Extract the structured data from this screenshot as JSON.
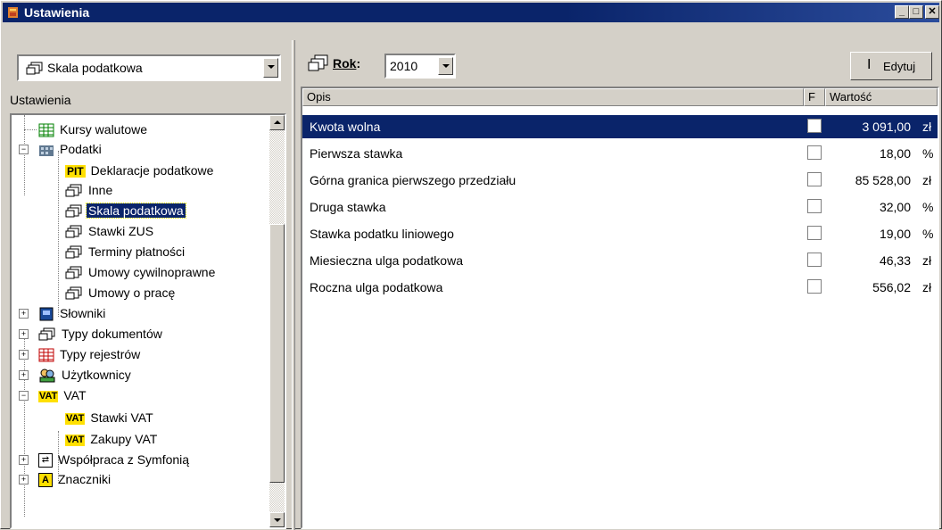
{
  "window": {
    "title": "Ustawienia"
  },
  "left": {
    "combo_value": "Skala podatkowa",
    "section_label": "Ustawienia",
    "tree": [
      {
        "label": "Kursy walutowe",
        "icon": "grid-table-icon"
      },
      {
        "label": "Podatki",
        "icon": "building-icon"
      },
      {
        "label": "Deklaracje podatkowe",
        "icon": "pit-icon"
      },
      {
        "label": "Inne",
        "icon": "folder-stack-icon"
      },
      {
        "label": "Skala podatkowa",
        "icon": "folder-stack-icon"
      },
      {
        "label": "Stawki ZUS",
        "icon": "folder-stack-icon"
      },
      {
        "label": "Terminy płatności",
        "icon": "folder-stack-icon"
      },
      {
        "label": "Umowy cywilnoprawne",
        "icon": "folder-stack-icon"
      },
      {
        "label": "Umowy o pracę",
        "icon": "folder-stack-icon"
      },
      {
        "label": "Słowniki",
        "icon": "dictionary-icon"
      },
      {
        "label": "Typy dokumentów",
        "icon": "folder-stack-icon"
      },
      {
        "label": "Typy rejestrów",
        "icon": "register-icon"
      },
      {
        "label": "Użytkownicy",
        "icon": "users-icon"
      },
      {
        "label": "VAT",
        "icon": "vat-icon"
      },
      {
        "label": "Stawki VAT",
        "icon": "vat-icon"
      },
      {
        "label": "Zakupy VAT",
        "icon": "vat-icon"
      },
      {
        "label": "Współpraca z Symfonią",
        "icon": "sync-icon"
      },
      {
        "label": "Znaczniki",
        "icon": "marker-icon"
      }
    ]
  },
  "right": {
    "rok_label": "Rok",
    "rok_colon": ":",
    "rok_value": "2010",
    "edit_label": "Edytuj",
    "columns": {
      "opis": "Opis",
      "f": "F",
      "wartosc": "Wartość"
    },
    "rows": [
      {
        "opis": "Kwota wolna",
        "value": "3 091,00",
        "unit": "zł"
      },
      {
        "opis": "Pierwsza stawka",
        "value": "18,00",
        "unit": "%"
      },
      {
        "opis": "Górna granica pierwszego przedziału",
        "value": "85 528,00",
        "unit": "zł"
      },
      {
        "opis": "Druga stawka",
        "value": "32,00",
        "unit": "%"
      },
      {
        "opis": "Stawka podatku liniowego",
        "value": "19,00",
        "unit": "%"
      },
      {
        "opis": "Miesieczna ulga podatkowa",
        "value": "46,33",
        "unit": "zł"
      },
      {
        "opis": "Roczna ulga podatkowa",
        "value": "556,02",
        "unit": "zł"
      }
    ]
  }
}
